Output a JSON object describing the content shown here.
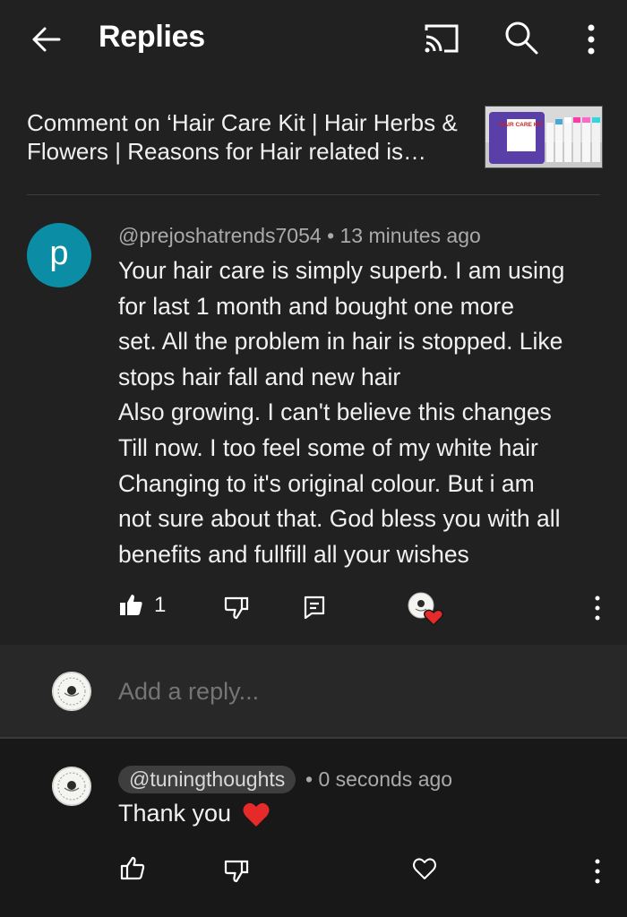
{
  "header": {
    "title": "Replies",
    "icons": [
      "back-arrow-icon",
      "cast-icon",
      "search-icon",
      "more-vert-icon"
    ]
  },
  "video": {
    "title": "Comment on ‘Hair Care Kit | Hair Herbs & Flowers | Reasons for Hair related is…",
    "thumbnail_label": "HAIR CARE KIT"
  },
  "comment": {
    "avatar_letter": "p",
    "avatar_color": "#0b8ea5",
    "author": "@prejoshatrends7054",
    "separator": "•",
    "time": "13 minutes ago",
    "text": "Your hair care is simply superb. I am using\nfor last 1 month and bought one more\nset. All the problem in hair is stopped. Like\nstops hair fall and new hair\nAlso growing. I can't believe this changes\nTill now. I too feel some of my white hair\nChanging to it's original colour. But i am\nnot sure about that. God bless you with all\nbenefits and fullfill all your wishes",
    "like_count": "1"
  },
  "add_reply": {
    "placeholder": "Add a reply..."
  },
  "reply": {
    "author": "@tuningthoughts",
    "separator": "•",
    "time": "0 seconds ago",
    "text": "Thank you"
  },
  "colors": {
    "background": "#181818",
    "panel": "#212121",
    "reply_box": "#282828",
    "heart": "#e62a2a"
  }
}
